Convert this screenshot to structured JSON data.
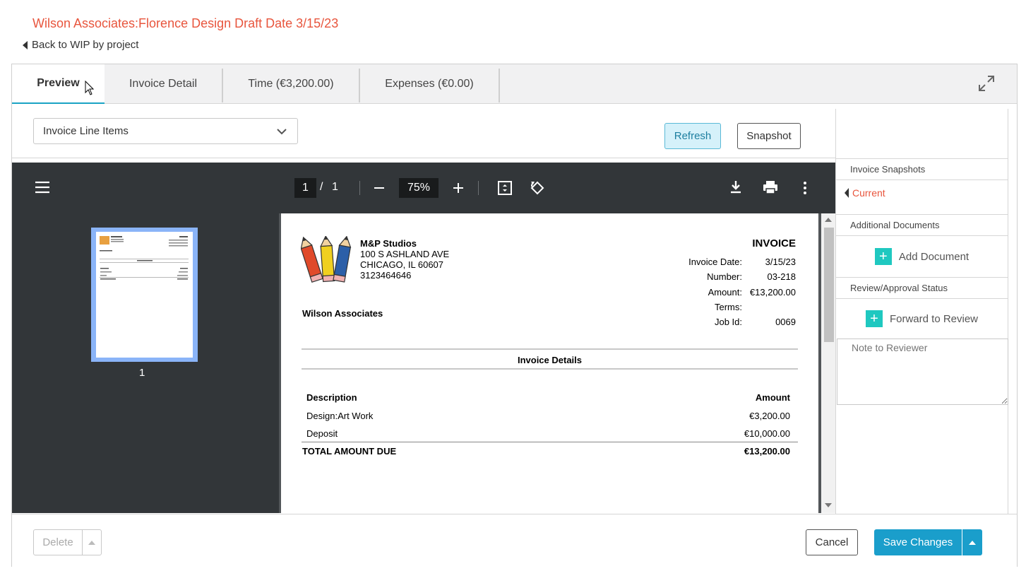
{
  "header": {
    "title": "Wilson Associates:Florence Design Draft Date 3/15/23",
    "back_label": "Back to WIP by project"
  },
  "tabs": [
    {
      "label": "Preview",
      "active": true
    },
    {
      "label": "Invoice Detail"
    },
    {
      "label": "Time (€3,200.00)"
    },
    {
      "label": "Expenses (€0.00)"
    }
  ],
  "toolbar": {
    "view_select": "Invoice Line Items",
    "refresh_label": "Refresh",
    "snapshot_label": "Snapshot"
  },
  "viewer": {
    "page_current": "1",
    "page_sep": "/",
    "page_total": "1",
    "zoom": "75%",
    "thumb_label": "1"
  },
  "invoice": {
    "company_name": "M&P Studios",
    "address1": "100 S ASHLAND AVE",
    "address2": "CHICAGO, IL 60607",
    "phone": "3123464646",
    "client": "Wilson Associates",
    "heading": "INVOICE",
    "meta": [
      {
        "label": "Invoice Date:",
        "value": "3/15/23"
      },
      {
        "label": "Number:",
        "value": "03-218"
      },
      {
        "label": "Amount:",
        "value": "€13,200.00"
      },
      {
        "label": "Terms:",
        "value": ""
      },
      {
        "label": "Job Id:",
        "value": "0069"
      }
    ],
    "details_title": "Invoice Details",
    "col_description": "Description",
    "col_amount": "Amount",
    "lines": [
      {
        "description": "Design:Art Work",
        "amount": "€3,200.00"
      },
      {
        "description": "Deposit",
        "amount": "€10,000.00"
      }
    ],
    "total_label": "TOTAL AMOUNT DUE",
    "total_amount": "€13,200.00"
  },
  "sidebar": {
    "snapshots_head": "Invoice Snapshots",
    "current_label": "Current",
    "additional_head": "Additional Documents",
    "add_document": "Add Document",
    "review_head": "Review/Approval Status",
    "forward_review": "Forward to Review",
    "note_placeholder": "Note to Reviewer"
  },
  "footer": {
    "delete_label": "Delete",
    "cancel_label": "Cancel",
    "save_label": "Save Changes"
  },
  "colors": {
    "accent": "#1a9ecb",
    "title": "#e8553d",
    "plus": "#1fc8c0"
  }
}
